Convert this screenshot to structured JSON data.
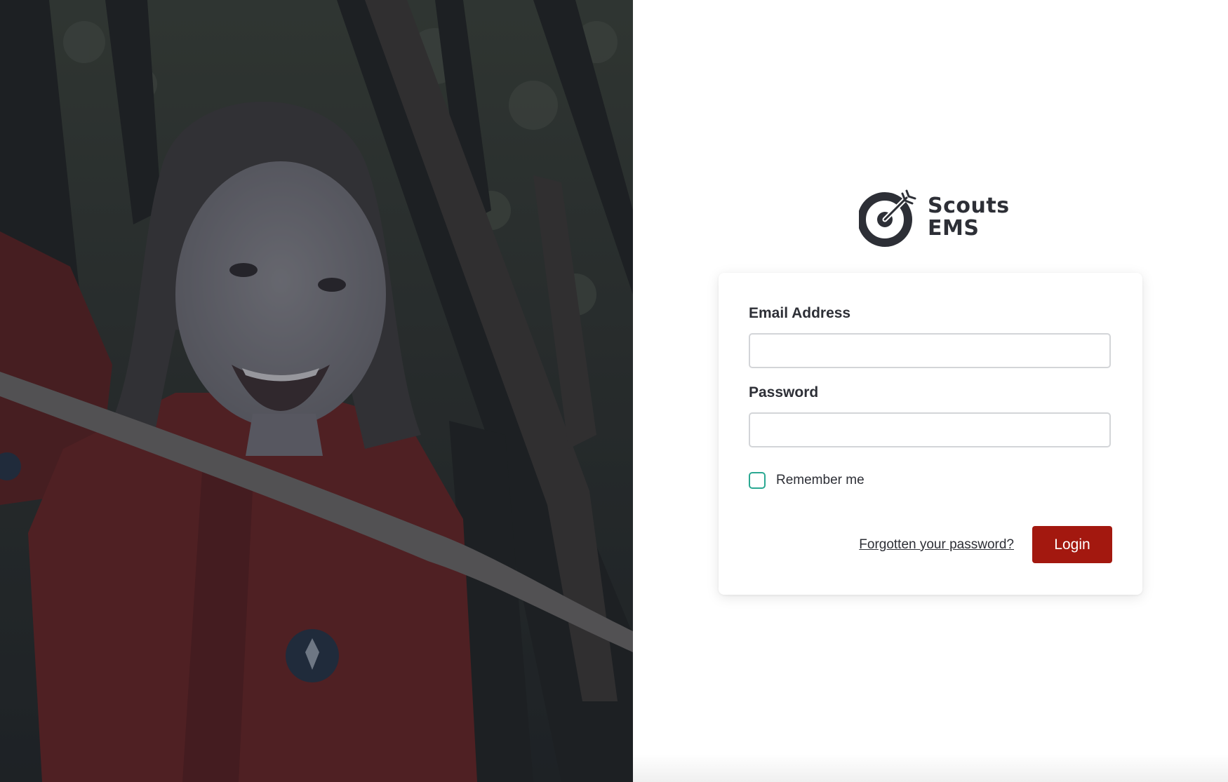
{
  "brand": {
    "name_line1": "Scouts",
    "name_line2": "EMS",
    "logo_icon": "target-arrow-icon",
    "color": "#2d2f36"
  },
  "hero_image": {
    "subject": "scout-photo"
  },
  "login_form": {
    "email_label": "Email Address",
    "email_value": "",
    "email_placeholder": "",
    "password_label": "Password",
    "password_value": "",
    "password_placeholder": "",
    "remember_label": "Remember me",
    "remember_checked": false,
    "forgot_link": "Forgotten your password?",
    "login_button": "Login"
  },
  "colors": {
    "accent": "#a3180f",
    "checkbox_border": "#2aa892",
    "text": "#2d2f36"
  }
}
